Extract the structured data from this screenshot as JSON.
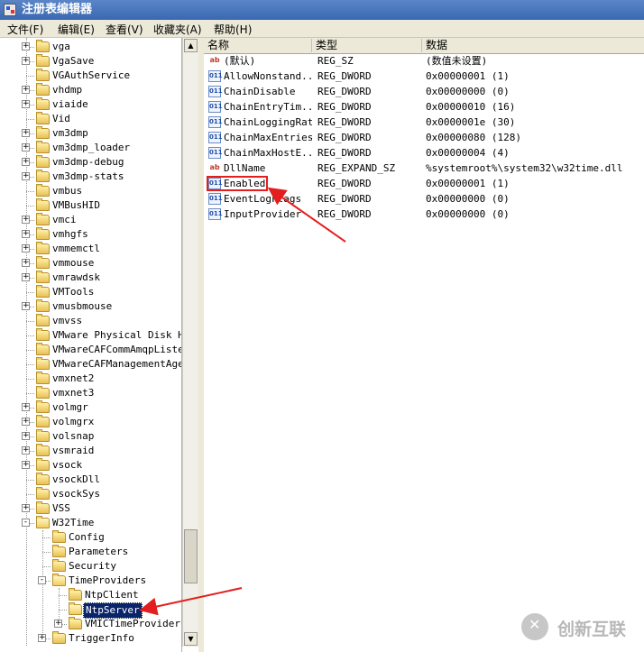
{
  "window": {
    "title": "注册表编辑器"
  },
  "menu": [
    "文件(F)",
    "编辑(E)",
    "查看(V)",
    "收藏夹(A)",
    "帮助(H)"
  ],
  "tree": {
    "items": [
      {
        "label": "vga",
        "expand": "+",
        "level": 1
      },
      {
        "label": "VgaSave",
        "expand": "+",
        "level": 1
      },
      {
        "label": "VGAuthService",
        "expand": "",
        "level": 1
      },
      {
        "label": "vhdmp",
        "expand": "+",
        "level": 1
      },
      {
        "label": "viaide",
        "expand": "+",
        "level": 1
      },
      {
        "label": "Vid",
        "expand": "",
        "level": 1
      },
      {
        "label": "vm3dmp",
        "expand": "+",
        "level": 1
      },
      {
        "label": "vm3dmp_loader",
        "expand": "+",
        "level": 1
      },
      {
        "label": "vm3dmp-debug",
        "expand": "+",
        "level": 1
      },
      {
        "label": "vm3dmp-stats",
        "expand": "+",
        "level": 1
      },
      {
        "label": "vmbus",
        "expand": "",
        "level": 1
      },
      {
        "label": "VMBusHID",
        "expand": "",
        "level": 1
      },
      {
        "label": "vmci",
        "expand": "+",
        "level": 1
      },
      {
        "label": "vmhgfs",
        "expand": "+",
        "level": 1
      },
      {
        "label": "vmmemctl",
        "expand": "+",
        "level": 1
      },
      {
        "label": "vmmouse",
        "expand": "+",
        "level": 1
      },
      {
        "label": "vmrawdsk",
        "expand": "+",
        "level": 1
      },
      {
        "label": "VMTools",
        "expand": "",
        "level": 1
      },
      {
        "label": "vmusbmouse",
        "expand": "+",
        "level": 1
      },
      {
        "label": "vmvss",
        "expand": "",
        "level": 1
      },
      {
        "label": "VMware Physical Disk Hel",
        "expand": "",
        "level": 1
      },
      {
        "label": "VMwareCAFCommAmqpListene",
        "expand": "",
        "level": 1
      },
      {
        "label": "VMwareCAFManagementAgent",
        "expand": "",
        "level": 1
      },
      {
        "label": "vmxnet2",
        "expand": "",
        "level": 1
      },
      {
        "label": "vmxnet3",
        "expand": "",
        "level": 1
      },
      {
        "label": "volmgr",
        "expand": "+",
        "level": 1
      },
      {
        "label": "volmgrx",
        "expand": "+",
        "level": 1
      },
      {
        "label": "volsnap",
        "expand": "+",
        "level": 1
      },
      {
        "label": "vsmraid",
        "expand": "+",
        "level": 1
      },
      {
        "label": "vsock",
        "expand": "+",
        "level": 1
      },
      {
        "label": "vsockDll",
        "expand": "",
        "level": 1
      },
      {
        "label": "vsockSys",
        "expand": "",
        "level": 1
      },
      {
        "label": "VSS",
        "expand": "+",
        "level": 1
      },
      {
        "label": "W32Time",
        "expand": "-",
        "level": 1
      },
      {
        "label": "Config",
        "expand": "",
        "level": 2
      },
      {
        "label": "Parameters",
        "expand": "",
        "level": 2
      },
      {
        "label": "Security",
        "expand": "",
        "level": 2
      },
      {
        "label": "TimeProviders",
        "expand": "-",
        "level": 2
      },
      {
        "label": "NtpClient",
        "expand": "",
        "level": 3
      },
      {
        "label": "NtpServer",
        "expand": "",
        "level": 3,
        "selected": true
      },
      {
        "label": "VMICTimeProvider",
        "expand": "+",
        "level": 3
      },
      {
        "label": "TriggerInfo",
        "expand": "+",
        "level": 2
      }
    ]
  },
  "list": {
    "headers": [
      "名称",
      "类型",
      "数据"
    ],
    "rows": [
      {
        "icon": "string-value-icon",
        "name": "(默认)",
        "type": "REG_SZ",
        "data": "(数值未设置)"
      },
      {
        "icon": "dword-value-icon",
        "name": "AllowNonstand...",
        "type": "REG_DWORD",
        "data": "0x00000001 (1)"
      },
      {
        "icon": "dword-value-icon",
        "name": "ChainDisable",
        "type": "REG_DWORD",
        "data": "0x00000000 (0)"
      },
      {
        "icon": "dword-value-icon",
        "name": "ChainEntryTim...",
        "type": "REG_DWORD",
        "data": "0x00000010 (16)"
      },
      {
        "icon": "dword-value-icon",
        "name": "ChainLoggingRate",
        "type": "REG_DWORD",
        "data": "0x0000001e (30)"
      },
      {
        "icon": "dword-value-icon",
        "name": "ChainMaxEntries",
        "type": "REG_DWORD",
        "data": "0x00000080 (128)"
      },
      {
        "icon": "dword-value-icon",
        "name": "ChainMaxHostE...",
        "type": "REG_DWORD",
        "data": "0x00000004 (4)"
      },
      {
        "icon": "string-value-icon",
        "name": "DllName",
        "type": "REG_EXPAND_SZ",
        "data": "%systemroot%\\system32\\w32time.dll"
      },
      {
        "icon": "dword-value-icon",
        "name": "Enabled",
        "type": "REG_DWORD",
        "data": "0x00000001 (1)",
        "highlighted": true
      },
      {
        "icon": "dword-value-icon",
        "name": "EventLogFlags",
        "type": "REG_DWORD",
        "data": "0x00000000 (0)"
      },
      {
        "icon": "dword-value-icon",
        "name": "InputProvider",
        "type": "REG_DWORD",
        "data": "0x00000000 (0)"
      }
    ]
  },
  "annotation": {
    "color": "#e41e1e"
  },
  "watermark": {
    "text": "创新互联"
  }
}
